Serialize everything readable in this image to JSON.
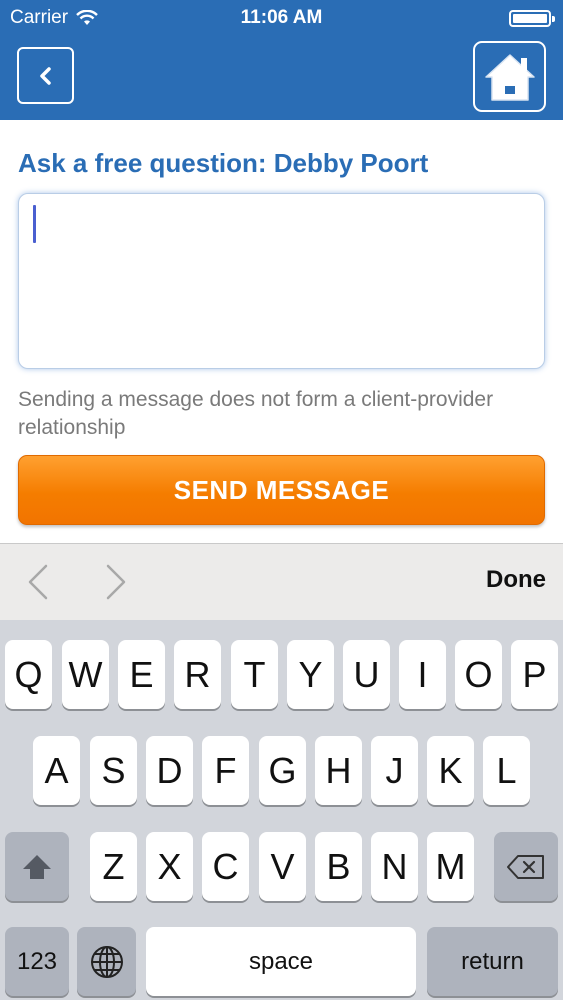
{
  "status_bar": {
    "carrier": "Carrier",
    "time": "11:06 AM"
  },
  "nav": {
    "back_icon": "chevron-left-icon",
    "home_icon": "home-icon"
  },
  "form": {
    "title": "Ask a free question: Debby Poort",
    "message_value": "",
    "disclaimer": "Sending a message does not form a client-provider relationship",
    "send_label": "SEND MESSAGE"
  },
  "accessory": {
    "done_label": "Done"
  },
  "keyboard": {
    "row1": [
      "Q",
      "W",
      "E",
      "R",
      "T",
      "Y",
      "U",
      "I",
      "O",
      "P"
    ],
    "row2": [
      "A",
      "S",
      "D",
      "F",
      "G",
      "H",
      "J",
      "K",
      "L"
    ],
    "row3": [
      "Z",
      "X",
      "C",
      "V",
      "B",
      "N",
      "M"
    ],
    "numbers_label": "123",
    "space_label": "space",
    "return_label": "return"
  },
  "colors": {
    "header_blue": "#2a6db5",
    "send_orange": "#f57d00"
  }
}
